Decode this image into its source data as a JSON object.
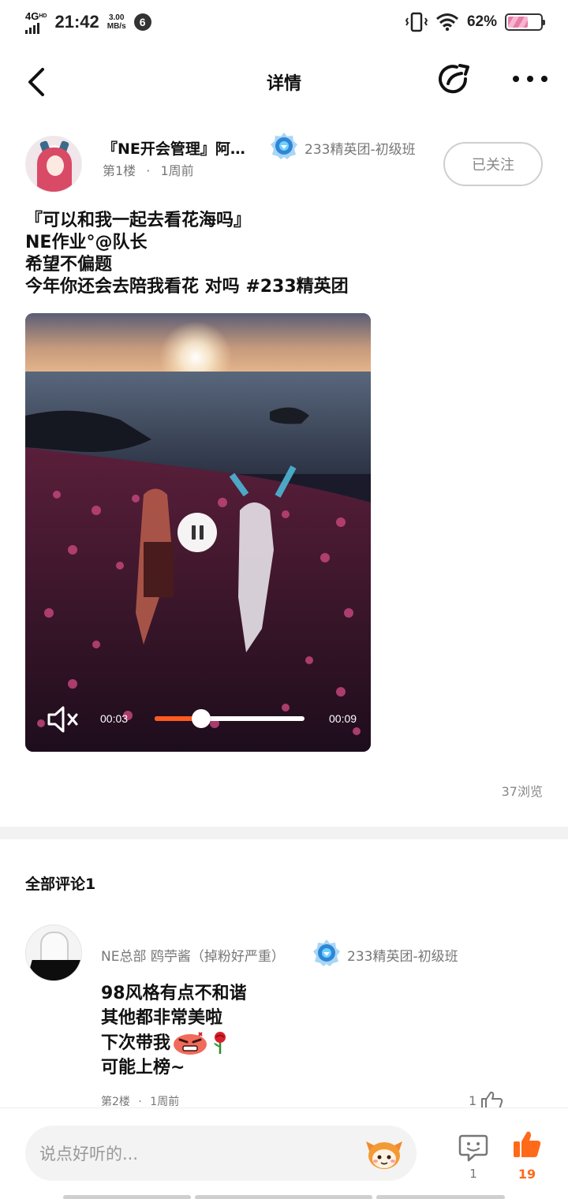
{
  "status_bar": {
    "network": "4G",
    "network_sup": "HD",
    "time": "21:42",
    "speed_value": "3.00",
    "speed_unit": "MB/s",
    "notification_count": "6",
    "battery": "62%"
  },
  "header": {
    "title": "详情"
  },
  "post": {
    "author_name": "『NE开会管理』阿…",
    "author_badge": "233精英团-初级班",
    "floor": "第1楼",
    "dot": "·",
    "time": "1周前",
    "follow_label": "已关注",
    "lines": [
      "『可以和我一起去看花海吗』",
      "NE作业°@队长",
      "希望不偏题",
      "今年你还会去陪我看花 对吗 #233精英团"
    ],
    "video": {
      "current_time": "00:03",
      "total_time": "00:09",
      "progress": 0.31,
      "muted": true,
      "playing": true
    },
    "views": "37浏览"
  },
  "comments": {
    "title": "全部评论1",
    "items": [
      {
        "name": "NE总部 鸥苧酱（掉粉好严重）",
        "badge": "233精英团-初级班",
        "lines": [
          "98风格有点不和谐",
          "其他都非常美啦",
          "下次带我",
          "可能上榜~"
        ],
        "floor": "第2楼",
        "dot": "·",
        "time": "1周前",
        "likes": "1"
      }
    ]
  },
  "bottom_bar": {
    "input_placeholder": "说点好听的...",
    "comment_count": "1",
    "like_count": "19"
  },
  "colors": {
    "accent": "#ff6a1a",
    "progress_fill": "#ff5a1f",
    "muted_text": "#777777"
  },
  "icons": [
    "back-icon",
    "share-icon",
    "more-icon",
    "verified-badge-icon",
    "pause-icon",
    "mute-icon",
    "comment-icon",
    "thumbs-up-icon",
    "angry-emoji-icon",
    "rose-emoji-icon",
    "mascot-icon"
  ]
}
